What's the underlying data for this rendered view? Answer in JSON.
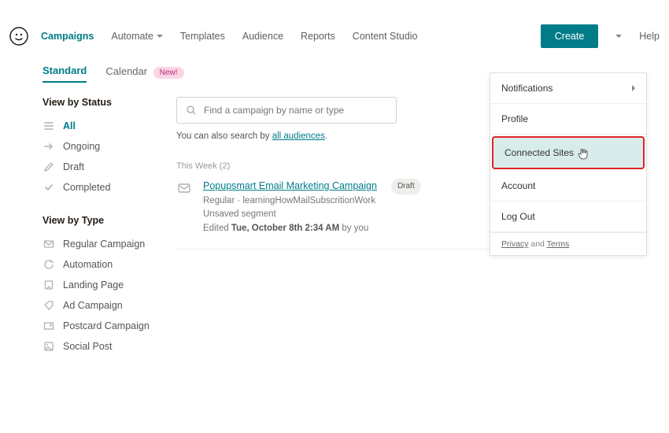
{
  "nav": {
    "items": [
      "Campaigns",
      "Automate",
      "Templates",
      "Audience",
      "Reports",
      "Content Studio"
    ],
    "create": "Create",
    "help": "Help"
  },
  "tabs": {
    "standard": "Standard",
    "calendar": "Calendar",
    "new_badge": "New!"
  },
  "sidebar": {
    "status_heading": "View by Status",
    "status": [
      {
        "label": "All"
      },
      {
        "label": "Ongoing"
      },
      {
        "label": "Draft"
      },
      {
        "label": "Completed"
      }
    ],
    "type_heading": "View by Type",
    "types": [
      {
        "label": "Regular Campaign"
      },
      {
        "label": "Automation"
      },
      {
        "label": "Landing Page"
      },
      {
        "label": "Ad Campaign"
      },
      {
        "label": "Postcard Campaign"
      },
      {
        "label": "Social Post"
      }
    ]
  },
  "search": {
    "placeholder": "Find a campaign by name or type",
    "sub_pre": "You can also search by ",
    "sub_link": "all audiences"
  },
  "section": {
    "label": "This Week (2)"
  },
  "campaign": {
    "title": "Popupsmart Email Marketing Campaign",
    "badge": "Draft",
    "line2": "Regular · learningHowMailSubscritionWork",
    "line3": "Unsaved segment",
    "edited_pre": "Edited ",
    "edited_time": "Tue, October 8th 2:34 AM",
    "edited_suf": " by you"
  },
  "dropdown": {
    "items": [
      "Notifications",
      "Profile",
      "Connected Sites",
      "Account",
      "Log Out"
    ],
    "foot_privacy": "Privacy",
    "foot_and": " and ",
    "foot_terms": "Terms"
  }
}
